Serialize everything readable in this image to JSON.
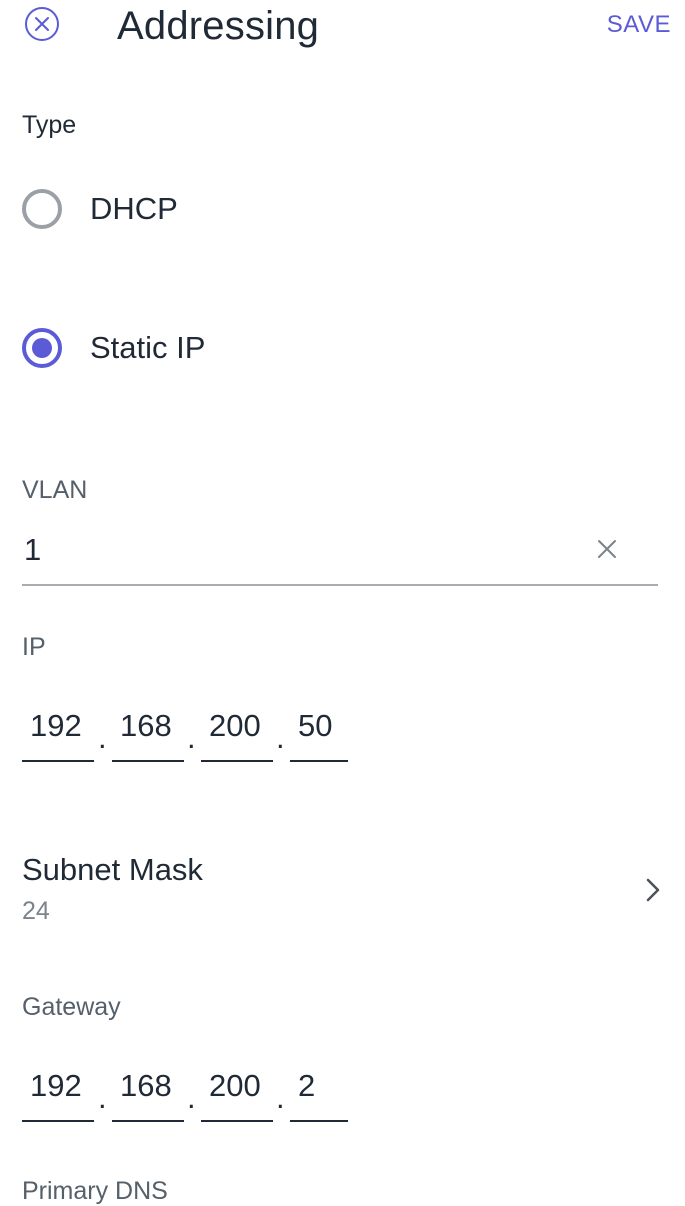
{
  "header": {
    "title": "Addressing",
    "save_label": "SAVE"
  },
  "type_section": {
    "label": "Type",
    "options": [
      {
        "label": "DHCP",
        "selected": false
      },
      {
        "label": "Static IP",
        "selected": true
      }
    ]
  },
  "vlan": {
    "label": "VLAN",
    "value": "1"
  },
  "ip": {
    "label": "IP",
    "octets": [
      "192",
      "168",
      "200",
      "50"
    ]
  },
  "subnet_mask": {
    "label": "Subnet Mask",
    "value": "24"
  },
  "gateway": {
    "label": "Gateway",
    "octets": [
      "192",
      "168",
      "200",
      "2"
    ]
  },
  "primary_dns": {
    "label": "Primary DNS"
  },
  "separator": ".",
  "colors": {
    "accent": "#5b5bd6",
    "text": "#1f2a36",
    "muted": "#7b838b",
    "radio_off": "#9aa0a6"
  },
  "icons": [
    "close-circle-icon",
    "clear-x-icon",
    "chevron-right-icon"
  ]
}
